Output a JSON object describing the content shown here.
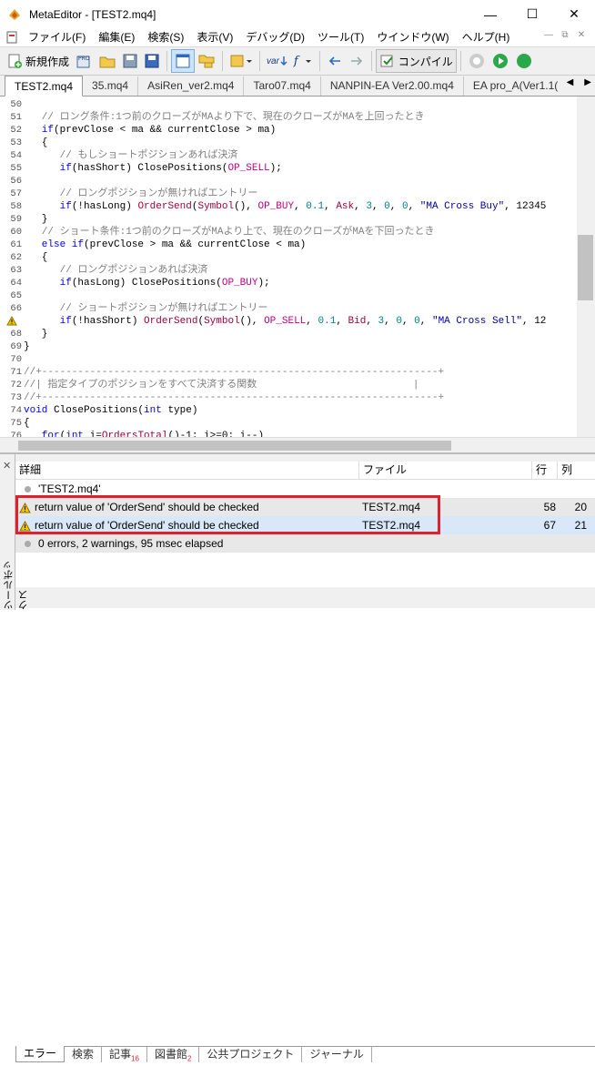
{
  "window": {
    "title": "MetaEditor - [TEST2.mq4]",
    "min": "—",
    "max": "☐",
    "close": "✕"
  },
  "menu": [
    "ファイル(F)",
    "編集(E)",
    "検索(S)",
    "表示(V)",
    "デバッグ(D)",
    "ツール(T)",
    "ウインドウ(W)",
    "ヘルプ(H)"
  ],
  "mdi": {
    "min": "—",
    "restore": "⧉",
    "close": "✕"
  },
  "toolbar": {
    "new_label": "新規作成",
    "var_label": "var",
    "f_label": "f",
    "compile_label": "コンパイル"
  },
  "tabs": [
    "TEST2.mq4",
    "35.mq4",
    "AsiRen_ver2.mq4",
    "Taro07.mq4",
    "NANPIN-EA Ver2.00.mq4",
    "EA pro_A(Ver1.1("
  ],
  "tab_arrows": {
    "left": "◀",
    "right": "▶"
  },
  "editor": {
    "lines": [
      {
        "n": "50",
        "parts": []
      },
      {
        "n": "51",
        "parts": [
          [
            "cm",
            "   // ロング条件:1つ前のクローズがMAより下で、現在のクローズがMAを上回ったとき"
          ]
        ]
      },
      {
        "n": "52",
        "parts": [
          [
            "kw",
            "   if"
          ],
          [
            "",
            "(prevClose < ma && currentClose > ma)"
          ]
        ]
      },
      {
        "n": "53",
        "parts": [
          [
            "",
            "   {"
          ]
        ]
      },
      {
        "n": "54",
        "parts": [
          [
            "cm",
            "      // もしショートポジションあれば決済"
          ]
        ]
      },
      {
        "n": "55",
        "parts": [
          [
            "kw",
            "      if"
          ],
          [
            "",
            "(hasShort) ClosePositions("
          ],
          [
            "cst",
            "OP_SELL"
          ],
          [
            "",
            ");"
          ]
        ]
      },
      {
        "n": "56",
        "parts": []
      },
      {
        "n": "57",
        "parts": [
          [
            "cm",
            "      // ロングポジションが無ければエントリー"
          ]
        ]
      },
      {
        "n": "58",
        "parts": [
          [
            "kw",
            "      if"
          ],
          [
            "",
            "(!hasLong) "
          ],
          [
            "fn",
            "OrderSend"
          ],
          [
            "",
            "("
          ],
          [
            "fn",
            "Symbol"
          ],
          [
            "",
            "(), "
          ],
          [
            "cst",
            "OP_BUY"
          ],
          [
            "",
            ", "
          ],
          [
            "num",
            "0.1"
          ],
          [
            "",
            ", "
          ],
          [
            "fn",
            "Ask"
          ],
          [
            "",
            ", "
          ],
          [
            "num",
            "3"
          ],
          [
            "",
            ", "
          ],
          [
            "num",
            "0"
          ],
          [
            "",
            ", "
          ],
          [
            "num",
            "0"
          ],
          [
            "",
            ", "
          ],
          [
            "str",
            "\"MA Cross Buy\""
          ],
          [
            "",
            ", 12345"
          ]
        ]
      },
      {
        "n": "59",
        "parts": [
          [
            "",
            "   }"
          ]
        ]
      },
      {
        "n": "60",
        "parts": [
          [
            "cm",
            "   // ショート条件:1つ前のクローズがMAより上で、現在のクローズがMAを下回ったとき"
          ]
        ]
      },
      {
        "n": "61",
        "parts": [
          [
            "kw",
            "   else if"
          ],
          [
            "",
            "(prevClose > ma && currentClose < ma)"
          ]
        ]
      },
      {
        "n": "62",
        "parts": [
          [
            "",
            "   {"
          ]
        ]
      },
      {
        "n": "63",
        "parts": [
          [
            "cm",
            "      // ロングポジションあれば決済"
          ]
        ]
      },
      {
        "n": "64",
        "parts": [
          [
            "kw",
            "      if"
          ],
          [
            "",
            "(hasLong) ClosePositions("
          ],
          [
            "cst",
            "OP_BUY"
          ],
          [
            "",
            ");"
          ]
        ]
      },
      {
        "n": "65",
        "parts": []
      },
      {
        "n": "66",
        "parts": [
          [
            "cm",
            "      // ショートポジションが無ければエントリー"
          ]
        ]
      },
      {
        "n": "67",
        "warn": true,
        "parts": [
          [
            "kw",
            "      if"
          ],
          [
            "",
            "(!hasShort) "
          ],
          [
            "fn",
            "OrderSend"
          ],
          [
            "",
            "("
          ],
          [
            "fn",
            "Symbol"
          ],
          [
            "",
            "(), "
          ],
          [
            "cst",
            "OP_SELL"
          ],
          [
            "",
            ", "
          ],
          [
            "num",
            "0.1"
          ],
          [
            "",
            ", "
          ],
          [
            "fn",
            "Bid"
          ],
          [
            "",
            ", "
          ],
          [
            "num",
            "3"
          ],
          [
            "",
            ", "
          ],
          [
            "num",
            "0"
          ],
          [
            "",
            ", "
          ],
          [
            "num",
            "0"
          ],
          [
            "",
            ", "
          ],
          [
            "str",
            "\"MA Cross Sell\""
          ],
          [
            "",
            ", 12"
          ]
        ]
      },
      {
        "n": "68",
        "parts": [
          [
            "",
            "   }"
          ]
        ]
      },
      {
        "n": "69",
        "parts": [
          [
            "",
            "}"
          ]
        ]
      },
      {
        "n": "70",
        "parts": []
      },
      {
        "n": "71",
        "parts": [
          [
            "cm",
            "//+------------------------------------------------------------------+"
          ]
        ]
      },
      {
        "n": "72",
        "parts": [
          [
            "cm",
            "//| 指定タイプのポジションをすべて決済する関数                          |"
          ]
        ]
      },
      {
        "n": "73",
        "parts": [
          [
            "cm",
            "//+------------------------------------------------------------------+"
          ]
        ]
      },
      {
        "n": "74",
        "parts": [
          [
            "kw",
            "void"
          ],
          [
            "",
            " ClosePositions("
          ],
          [
            "kw",
            "int"
          ],
          [
            "",
            " type)"
          ]
        ]
      },
      {
        "n": "75",
        "parts": [
          [
            "",
            "{"
          ]
        ]
      },
      {
        "n": "76",
        "parts": [
          [
            "kw",
            "   for"
          ],
          [
            "",
            "("
          ],
          [
            "kw",
            "int"
          ],
          [
            "",
            " i="
          ],
          [
            "fn",
            "OrdersTotal"
          ],
          [
            "",
            "()-1; i>=0; i--)"
          ]
        ]
      }
    ]
  },
  "toolbox": {
    "title": "ツールボックス",
    "close": "✕",
    "headers": {
      "detail": "詳細",
      "file": "ファイル",
      "row": "行",
      "col": "列"
    },
    "file_row": "'TEST2.mq4'",
    "warnings": [
      {
        "msg": "return value of 'OrderSend' should be checked",
        "file": "TEST2.mq4",
        "row": "58",
        "col": "20"
      },
      {
        "msg": "return value of 'OrderSend' should be checked",
        "file": "TEST2.mq4",
        "row": "67",
        "col": "21"
      }
    ],
    "summary": "0 errors, 2 warnings, 95 msec elapsed",
    "tabs": [
      {
        "label": "エラー",
        "badge": ""
      },
      {
        "label": "検索",
        "badge": ""
      },
      {
        "label": "記事",
        "badge": "16"
      },
      {
        "label": "図書館",
        "badge": "2"
      },
      {
        "label": "公共プロジェクト",
        "badge": ""
      },
      {
        "label": "ジャーナル",
        "badge": ""
      }
    ]
  }
}
